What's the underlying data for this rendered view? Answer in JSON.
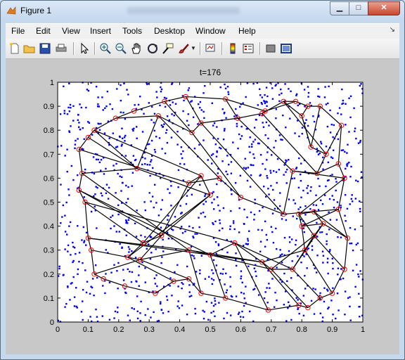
{
  "window": {
    "title": "Figure 1",
    "minimize_glyph": "▁",
    "maximize_glyph": "□",
    "close_glyph": "✕"
  },
  "menu": {
    "items": [
      "File",
      "Edit",
      "View",
      "Insert",
      "Tools",
      "Desktop",
      "Window",
      "Help"
    ],
    "dock_glyph": "↘"
  },
  "toolbar": {
    "buttons": [
      "new-figure-icon",
      "open-file-icon",
      "save-icon",
      "print-icon",
      "edit-plot-arrow-icon",
      "zoom-in-icon",
      "zoom-out-icon",
      "pan-hand-icon",
      "rotate-3d-icon",
      "data-cursor-icon",
      "brush-icon",
      "link-plot-icon",
      "colorbar-icon",
      "legend-icon",
      "hide-plot-tools-icon",
      "show-plot-tools-icon"
    ]
  },
  "colors": {
    "points": "#0000ff",
    "nodes": "#ff0000",
    "edges": "#000000",
    "figure_bg": "#c8c8c8",
    "axes_bg": "#ffffff"
  },
  "chart_data": {
    "type": "scatter",
    "title": "t=176",
    "xlim": [
      0,
      1
    ],
    "ylim": [
      0,
      1
    ],
    "xticks": [
      "0",
      "0.1",
      "0.2",
      "0.3",
      "0.4",
      "0.5",
      "0.6",
      "0.7",
      "0.8",
      "0.9",
      "1"
    ],
    "yticks": [
      "0",
      "0.1",
      "0.2",
      "0.3",
      "0.4",
      "0.5",
      "0.6",
      "0.7",
      "0.8",
      "0.9",
      "1"
    ],
    "point_marker": "dot",
    "point_color": "blue",
    "point_count_approx": 1200,
    "node_marker": "circle",
    "node_color": "red",
    "nodes": [
      [
        0.07,
        0.72
      ],
      [
        0.1,
        0.77
      ],
      [
        0.12,
        0.8
      ],
      [
        0.19,
        0.85
      ],
      [
        0.25,
        0.88
      ],
      [
        0.35,
        0.92
      ],
      [
        0.42,
        0.94
      ],
      [
        0.55,
        0.93
      ],
      [
        0.68,
        0.88
      ],
      [
        0.78,
        0.92
      ],
      [
        0.82,
        0.9
      ],
      [
        0.86,
        0.9
      ],
      [
        0.93,
        0.82
      ],
      [
        0.08,
        0.62
      ],
      [
        0.07,
        0.55
      ],
      [
        0.09,
        0.5
      ],
      [
        0.1,
        0.35
      ],
      [
        0.11,
        0.3
      ],
      [
        0.12,
        0.2
      ],
      [
        0.15,
        0.18
      ],
      [
        0.22,
        0.15
      ],
      [
        0.32,
        0.12
      ],
      [
        0.38,
        0.17
      ],
      [
        0.43,
        0.18
      ],
      [
        0.47,
        0.12
      ],
      [
        0.55,
        0.1
      ],
      [
        0.69,
        0.05
      ],
      [
        0.79,
        0.07
      ],
      [
        0.82,
        0.06
      ],
      [
        0.86,
        0.1
      ],
      [
        0.9,
        0.12
      ],
      [
        0.94,
        0.22
      ],
      [
        0.95,
        0.35
      ],
      [
        0.92,
        0.47
      ],
      [
        0.94,
        0.6
      ],
      [
        0.92,
        0.66
      ],
      [
        0.26,
        0.64
      ],
      [
        0.33,
        0.86
      ],
      [
        0.44,
        0.79
      ],
      [
        0.47,
        0.83
      ],
      [
        0.59,
        0.85
      ],
      [
        0.67,
        0.87
      ],
      [
        0.74,
        0.92
      ],
      [
        0.8,
        0.86
      ],
      [
        0.83,
        0.73
      ],
      [
        0.88,
        0.7
      ],
      [
        0.85,
        0.62
      ],
      [
        0.77,
        0.63
      ],
      [
        0.74,
        0.45
      ],
      [
        0.6,
        0.52
      ],
      [
        0.53,
        0.6
      ],
      [
        0.43,
        0.58
      ],
      [
        0.47,
        0.61
      ],
      [
        0.5,
        0.53
      ],
      [
        0.34,
        0.36
      ],
      [
        0.28,
        0.33
      ],
      [
        0.23,
        0.27
      ],
      [
        0.27,
        0.26
      ],
      [
        0.43,
        0.3
      ],
      [
        0.5,
        0.28
      ],
      [
        0.58,
        0.33
      ],
      [
        0.67,
        0.25
      ],
      [
        0.7,
        0.22
      ],
      [
        0.77,
        0.22
      ],
      [
        0.81,
        0.3
      ],
      [
        0.84,
        0.36
      ],
      [
        0.87,
        0.41
      ],
      [
        0.8,
        0.4
      ],
      [
        0.79,
        0.45
      ],
      [
        0.84,
        0.46
      ]
    ],
    "edges": [
      [
        0,
        1
      ],
      [
        1,
        2
      ],
      [
        2,
        3
      ],
      [
        3,
        4
      ],
      [
        4,
        5
      ],
      [
        5,
        6
      ],
      [
        6,
        7
      ],
      [
        7,
        8
      ],
      [
        8,
        9
      ],
      [
        9,
        10
      ],
      [
        10,
        11
      ],
      [
        11,
        12
      ],
      [
        0,
        13
      ],
      [
        13,
        14
      ],
      [
        14,
        15
      ],
      [
        15,
        16
      ],
      [
        16,
        17
      ],
      [
        17,
        18
      ],
      [
        18,
        19
      ],
      [
        19,
        20
      ],
      [
        20,
        21
      ],
      [
        21,
        22
      ],
      [
        22,
        23
      ],
      [
        23,
        24
      ],
      [
        24,
        25
      ],
      [
        25,
        26
      ],
      [
        26,
        27
      ],
      [
        27,
        28
      ],
      [
        28,
        29
      ],
      [
        29,
        30
      ],
      [
        30,
        31
      ],
      [
        31,
        32
      ],
      [
        32,
        33
      ],
      [
        33,
        34
      ],
      [
        34,
        35
      ],
      [
        35,
        12
      ],
      [
        2,
        36
      ],
      [
        36,
        37
      ],
      [
        37,
        38
      ],
      [
        38,
        39
      ],
      [
        39,
        40
      ],
      [
        40,
        41
      ],
      [
        41,
        42
      ],
      [
        42,
        43
      ],
      [
        43,
        44
      ],
      [
        44,
        45
      ],
      [
        45,
        46
      ],
      [
        46,
        47
      ],
      [
        47,
        48
      ],
      [
        48,
        49
      ],
      [
        49,
        50
      ],
      [
        50,
        51
      ],
      [
        51,
        52
      ],
      [
        52,
        53
      ],
      [
        53,
        54
      ],
      [
        54,
        55
      ],
      [
        55,
        56
      ],
      [
        56,
        57
      ],
      [
        57,
        58
      ],
      [
        58,
        59
      ],
      [
        59,
        60
      ],
      [
        60,
        61
      ],
      [
        61,
        62
      ],
      [
        62,
        63
      ],
      [
        63,
        64
      ],
      [
        64,
        65
      ],
      [
        65,
        66
      ],
      [
        66,
        67
      ],
      [
        67,
        68
      ],
      [
        68,
        69
      ],
      [
        13,
        36
      ],
      [
        14,
        54
      ],
      [
        15,
        55
      ],
      [
        16,
        58
      ],
      [
        17,
        56
      ],
      [
        18,
        57
      ],
      [
        1,
        36
      ],
      [
        3,
        37
      ],
      [
        5,
        38
      ],
      [
        6,
        39
      ],
      [
        7,
        40
      ],
      [
        8,
        41
      ],
      [
        9,
        42
      ],
      [
        10,
        43
      ],
      [
        11,
        44
      ],
      [
        12,
        45
      ],
      [
        35,
        46
      ],
      [
        34,
        47
      ],
      [
        33,
        48
      ],
      [
        32,
        66
      ],
      [
        31,
        65
      ],
      [
        30,
        64
      ],
      [
        29,
        63
      ],
      [
        28,
        62
      ],
      [
        27,
        61
      ],
      [
        26,
        60
      ],
      [
        25,
        59
      ],
      [
        24,
        58
      ],
      [
        23,
        57
      ],
      [
        22,
        56
      ],
      [
        13,
        58
      ],
      [
        14,
        59
      ],
      [
        15,
        60
      ],
      [
        16,
        61
      ],
      [
        0,
        51
      ],
      [
        2,
        52
      ],
      [
        36,
        53
      ],
      [
        37,
        50
      ],
      [
        38,
        49
      ],
      [
        39,
        48
      ],
      [
        40,
        47
      ],
      [
        41,
        46
      ],
      [
        42,
        45
      ],
      [
        43,
        44
      ],
      [
        51,
        54
      ],
      [
        52,
        55
      ],
      [
        53,
        56
      ],
      [
        54,
        57
      ],
      [
        58,
        61
      ],
      [
        59,
        62
      ],
      [
        60,
        63
      ],
      [
        61,
        64
      ],
      [
        62,
        65
      ],
      [
        63,
        66
      ],
      [
        64,
        67
      ],
      [
        65,
        68
      ],
      [
        66,
        69
      ],
      [
        67,
        33
      ],
      [
        68,
        34
      ],
      [
        69,
        32
      ]
    ]
  }
}
